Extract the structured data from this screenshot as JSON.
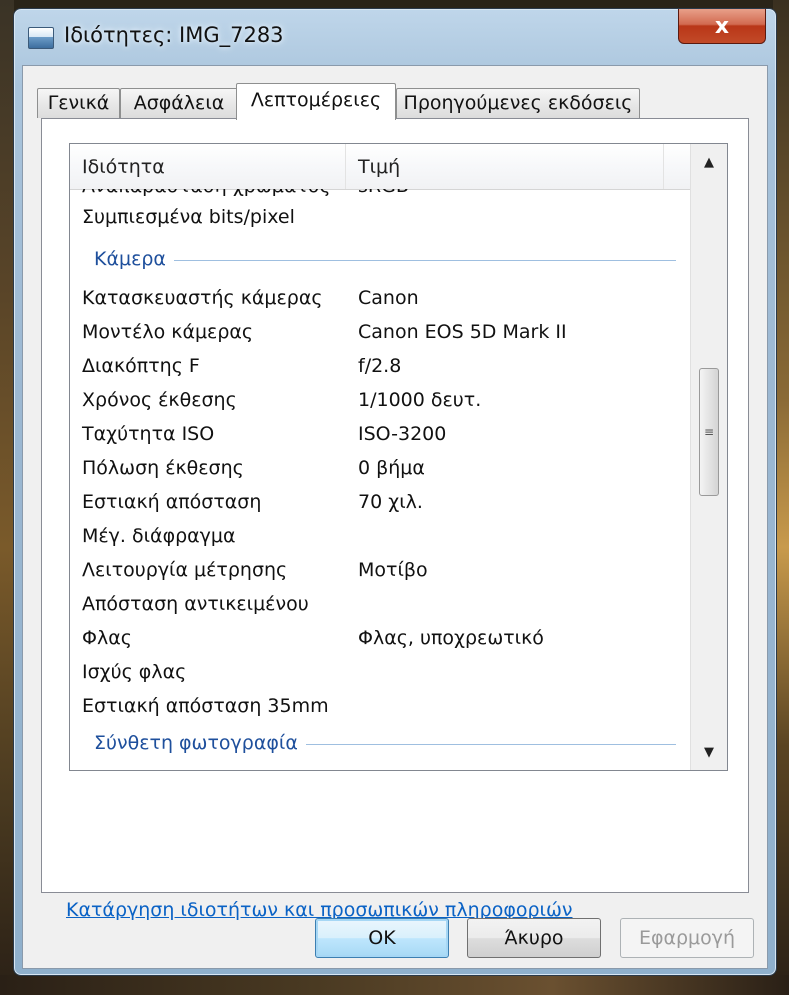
{
  "window": {
    "title": "Ιδιότητες: IMG_7283",
    "close_label": "x"
  },
  "tabs": [
    {
      "label": "Γενικά"
    },
    {
      "label": "Ασφάλεια"
    },
    {
      "label": "Λεπτομέρειες"
    },
    {
      "label": "Προηγούμενες εκδόσεις"
    }
  ],
  "details": {
    "columns": {
      "property": "Ιδιότητα",
      "value": "Τιμή"
    },
    "partial_row": {
      "property": "Αναπαράσταση χρώματος",
      "value": "sRGB"
    },
    "row_compressed": {
      "property": "Συμπιεσμένα bits/pixel",
      "value": ""
    },
    "camera_group": "Κάμερα",
    "camera_rows": [
      {
        "property": "Κατασκευαστής κάμερας",
        "value": "Canon"
      },
      {
        "property": "Μοντέλο κάμερας",
        "value": "Canon EOS 5D Mark II"
      },
      {
        "property": "Διακόπτης F",
        "value": "f/2.8"
      },
      {
        "property": "Χρόνος έκθεσης",
        "value": "1/1000 δευτ."
      },
      {
        "property": "Ταχύτητα ISO",
        "value": "ISO-3200"
      },
      {
        "property": "Πόλωση έκθεσης",
        "value": "0 βήμα"
      },
      {
        "property": "Εστιακή απόσταση",
        "value": "70 χιλ."
      },
      {
        "property": "Μέγ. διάφραγμα",
        "value": ""
      },
      {
        "property": "Λειτουργία μέτρησης",
        "value": "Μοτίβο"
      },
      {
        "property": "Απόσταση αντικειμένου",
        "value": ""
      },
      {
        "property": "Φλας",
        "value": "Φλας, υποχρεωτικό"
      },
      {
        "property": "Ισχύς φλας",
        "value": ""
      },
      {
        "property": "Εστιακή απόσταση 35mm",
        "value": ""
      }
    ],
    "next_group": "Σύνθετη φωτογραφία"
  },
  "remove_link": "Κατάργηση ιδιοτήτων και προσωπικών πληροφοριών",
  "buttons": {
    "ok": "OK",
    "cancel": "Άκυρο",
    "apply": "Εφαρμογή"
  }
}
